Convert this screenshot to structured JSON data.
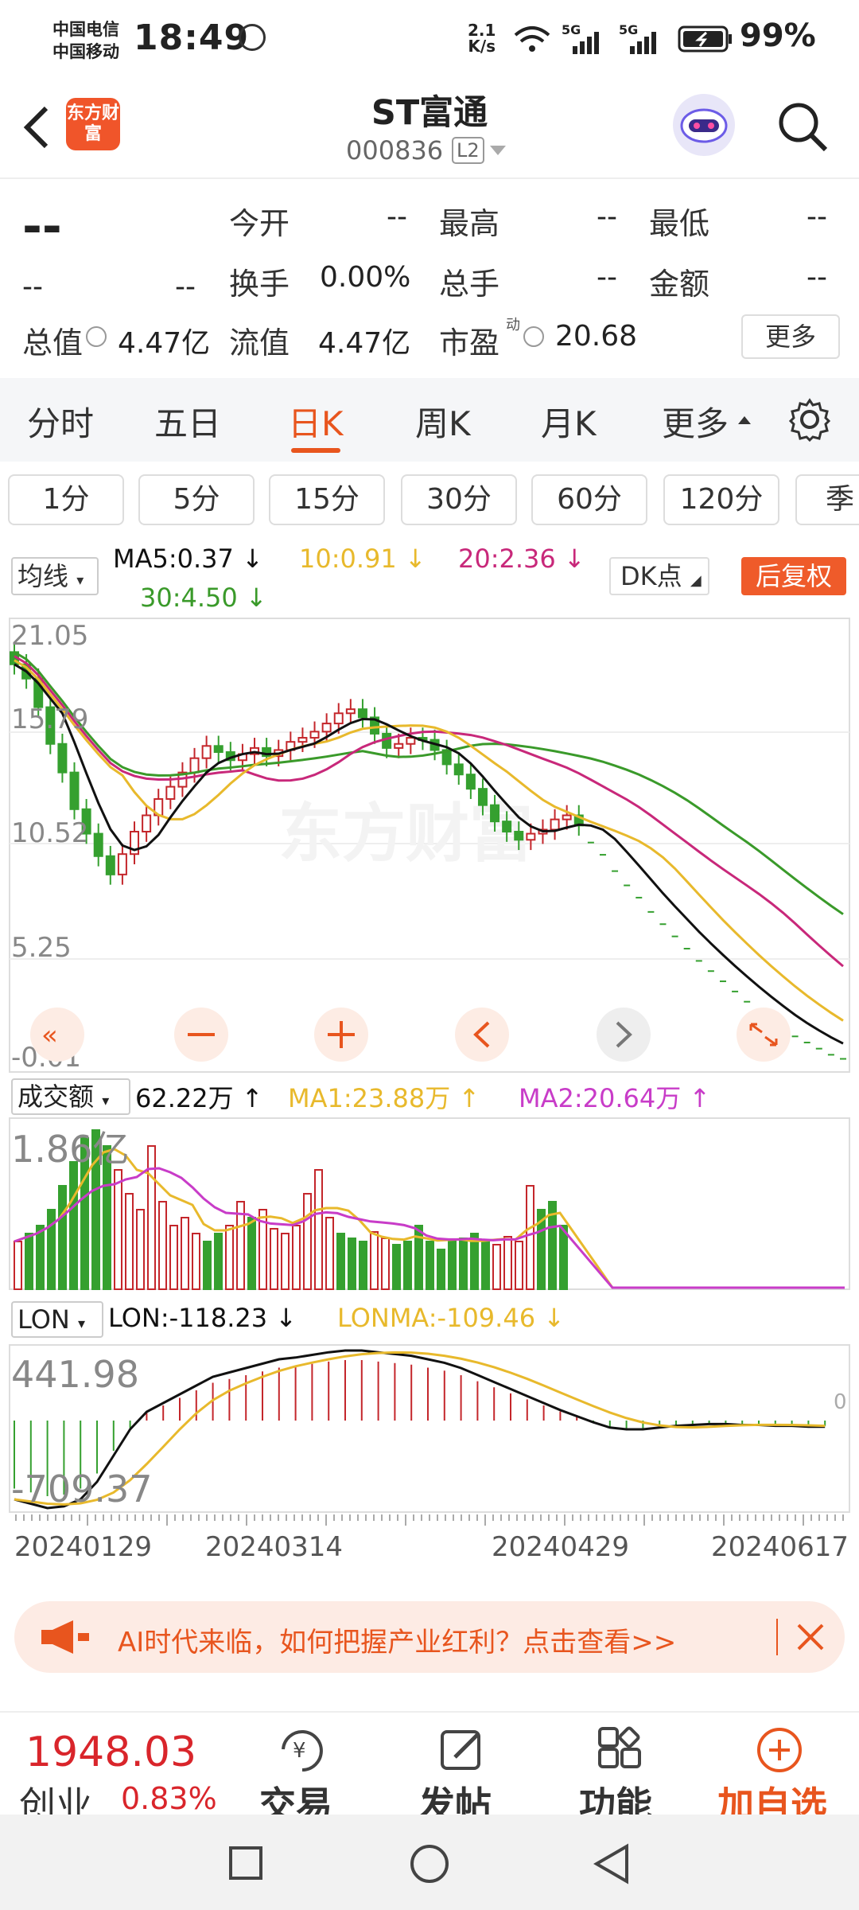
{
  "status": {
    "carrier1": "中国电信",
    "carrier2": "中国移动",
    "time": "18:49",
    "speed_top": "2.1",
    "speed_unit": "K/s",
    "net1": "5G",
    "net2": "5G",
    "battery": "99%"
  },
  "header": {
    "logo": "东方财富",
    "title": "ST富通",
    "code": "000836",
    "level": "L2"
  },
  "quote": {
    "price": "--",
    "change": "--",
    "change_pct": "--",
    "open_label": "今开",
    "open": "--",
    "high_label": "最高",
    "high": "--",
    "low_label": "最低",
    "low": "--",
    "turnover_label": "换手",
    "turnover": "0.00%",
    "volume_label": "总手",
    "volume": "--",
    "amount_label": "金额",
    "amount": "--",
    "mcap_label": "总值",
    "mcap": "4.47亿",
    "float_label": "流值",
    "float": "4.47亿",
    "pe_label": "市盈",
    "pe_sup": "动",
    "pe": "20.68",
    "more": "更多"
  },
  "tabs": [
    "分时",
    "五日",
    "日K",
    "周K",
    "月K",
    "更多"
  ],
  "active_tab": "日K",
  "intervals": [
    "1分",
    "5分",
    "15分",
    "30分",
    "60分",
    "120分",
    "季"
  ],
  "ma": {
    "control": "均线",
    "ma5": "MA5:0.37",
    "ma10": "10:0.91",
    "ma20": "20:2.36",
    "ma30": "30:4.50",
    "dk": "DK点",
    "fq": "后复权"
  },
  "price_axis": [
    "21.05",
    "15.79",
    "10.52",
    "5.25",
    "-0.01"
  ],
  "vol": {
    "control": "成交额",
    "value": "62.22万",
    "ma1": "MA1:23.88万",
    "ma2": "MA2:20.64万",
    "axis": "1.86亿"
  },
  "lon": {
    "control": "LON",
    "value": "LON:-118.23",
    "ma": "LONMA:-109.46",
    "axis_top": "441.98",
    "axis_bot": "-709.37",
    "zero": "0"
  },
  "dates": [
    "20240129",
    "20240314",
    "20240429",
    "20240617"
  ],
  "colors": {
    "up": "#c4262b",
    "down": "#35a02f",
    "ma5": "#111111",
    "ma10": "#e8b92c",
    "ma20": "#c8287a",
    "ma30": "#3a9a2a",
    "accent": "#e8551e"
  },
  "banner": {
    "text": "AI时代来临，如何把握产业红利？点击查看>>"
  },
  "bottom": {
    "index_value": "1948.03",
    "index_name": "创业",
    "index_change": "0.83%",
    "trade": "交易",
    "post": "发帖",
    "func": "功能",
    "watch": "加自选"
  },
  "chart_data": {
    "type": "candlestick",
    "x_range": [
      "20240129",
      "20240617"
    ],
    "price_axis": [
      21.05,
      15.79,
      10.52,
      5.25,
      -0.01
    ],
    "series": [
      {
        "name": "MA5",
        "last": 0.37
      },
      {
        "name": "MA10",
        "last": 0.91
      },
      {
        "name": "MA20",
        "last": 2.36
      },
      {
        "name": "MA30",
        "last": 4.5
      }
    ],
    "volume": {
      "last": "62.22万",
      "ma1": "23.88万",
      "ma2": "20.64万",
      "axis_max": "1.86亿"
    },
    "lon": {
      "lon": -118.23,
      "lonma": -109.46,
      "axis": [
        441.98,
        -709.37
      ]
    }
  }
}
